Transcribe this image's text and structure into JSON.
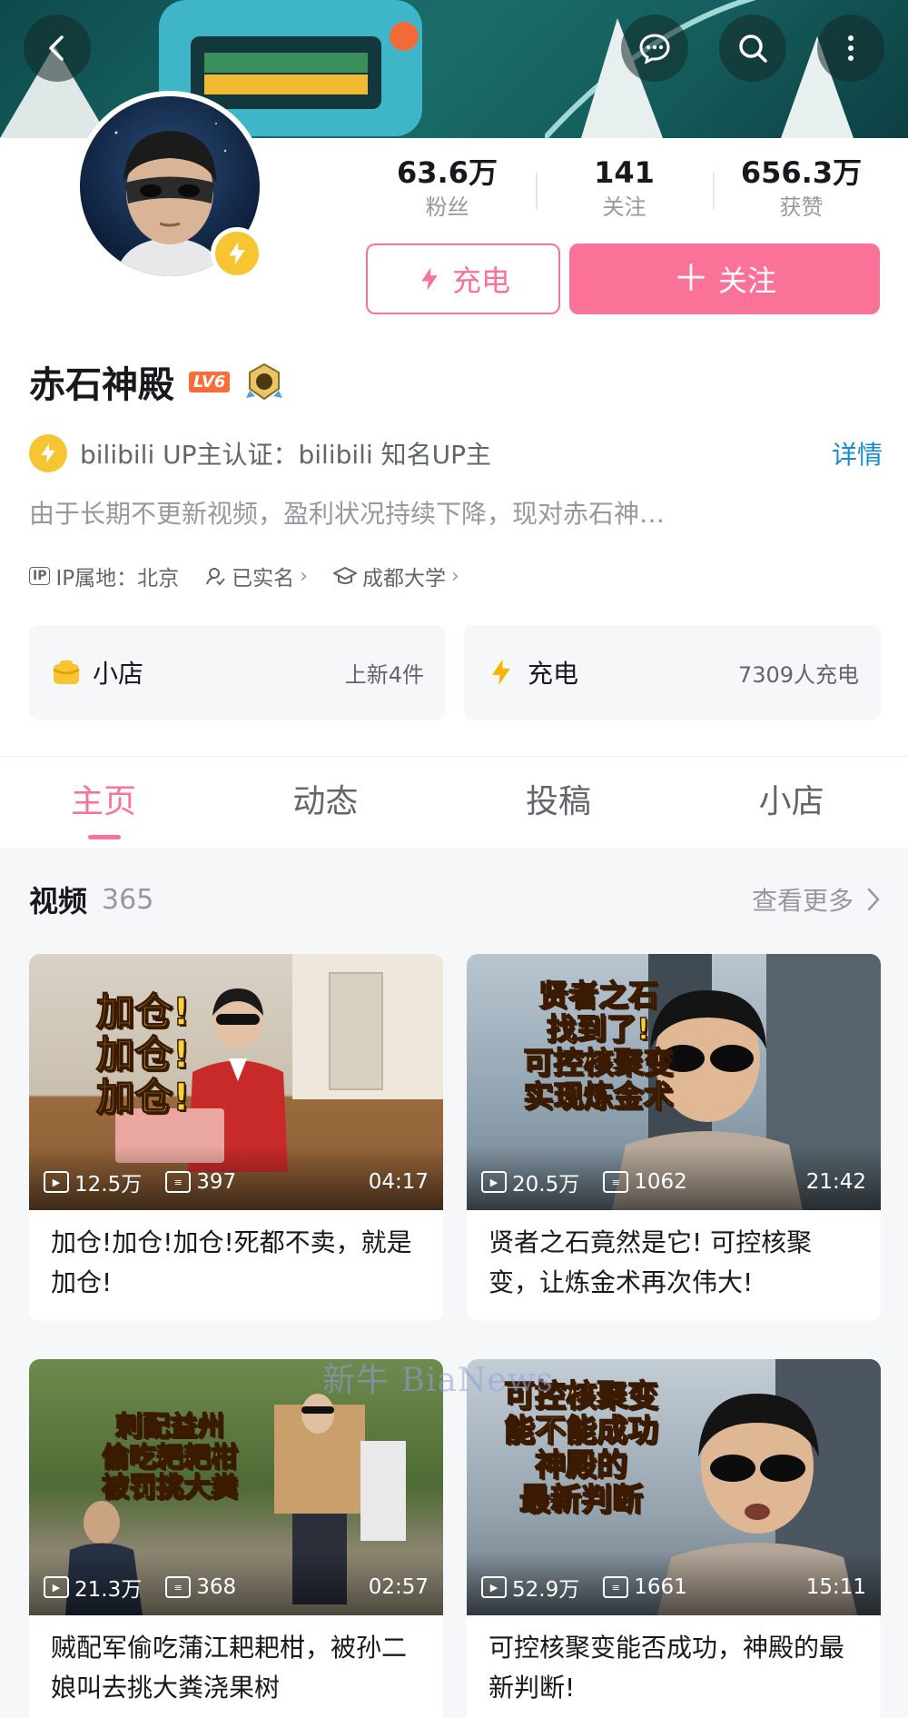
{
  "header": {
    "back_icon": "chevron-left-icon",
    "message_icon": "message-icon",
    "search_icon": "search-icon",
    "more_icon": "more-vertical-icon"
  },
  "profile": {
    "name": "赤石神殿",
    "level": "LV6",
    "stats": [
      {
        "value": "63.6万",
        "label": "粉丝"
      },
      {
        "value": "141",
        "label": "关注"
      },
      {
        "value": "656.3万",
        "label": "获赞"
      }
    ],
    "charge_button": "充电",
    "follow_button": "关注",
    "verify_text": "bilibili UP主认证：bilibili 知名UP主",
    "detail_link": "详情",
    "sign": "由于长期不更新视频，盈利状况持续下降，现对赤石神…",
    "ip_badge": "IP",
    "ip_location": "IP属地：北京",
    "real_name": "已实名",
    "school": "成都大学"
  },
  "cards": {
    "shop": {
      "title": "小店",
      "info": "上新4件"
    },
    "charge": {
      "title": "充电",
      "info": "7309人充电"
    }
  },
  "tabs": [
    "主页",
    "动态",
    "投稿",
    "小店"
  ],
  "videos_section": {
    "title": "视频",
    "count": "365",
    "more": "查看更多"
  },
  "videos": [
    {
      "caption": "加仓!\n加仓!\n加仓!",
      "views": "12.5万",
      "danmaku": "397",
      "duration": "04:17",
      "title": "加仓!加仓!加仓!死都不卖，就是加仓!"
    },
    {
      "caption": "贤者之石\n找到了!\n可控核聚变\n实现炼金术",
      "views": "20.5万",
      "danmaku": "1062",
      "duration": "21:42",
      "title": "贤者之石竟然是它! 可控核聚变，让炼金术再次伟大!"
    },
    {
      "caption": "刺配益州\n偷吃耙耙柑\n被罚挑大粪",
      "views": "21.3万",
      "danmaku": "368",
      "duration": "02:57",
      "title": "贼配军偷吃蒲江耙耙柑，被孙二娘叫去挑大粪浇果树"
    },
    {
      "caption": "可控核聚变\n能不能成功\n神殿的\n最新判断",
      "views": "52.9万",
      "danmaku": "1661",
      "duration": "15:11",
      "title": "可控核聚变能否成功，神殿的最新判断!"
    }
  ],
  "watermark": "新牛 BiaNews"
}
